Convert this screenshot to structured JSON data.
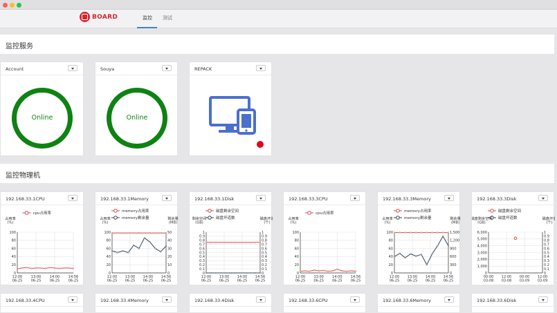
{
  "app": {
    "brand": "BOARD",
    "tabs": [
      {
        "label": "监控",
        "active": true
      },
      {
        "label": "测试",
        "active": false
      }
    ],
    "colors": {
      "brand": "#d7262d",
      "online": "#0e8212",
      "tab_underline": "#3a86c8",
      "status_dot": "#e8001c"
    }
  },
  "services": {
    "title": "监控服务",
    "cards": [
      {
        "name": "Account",
        "status": "Online",
        "icon": "ring"
      },
      {
        "name": "Souya",
        "status": "Online",
        "icon": "ring"
      },
      {
        "name": "REPACK",
        "status": "",
        "icon": "desktop-phone-icon",
        "status_dot": "red"
      }
    ]
  },
  "machines": {
    "title": "监控物理机",
    "row1": [
      {
        "name": "192.168.33.1CPU"
      },
      {
        "name": "192.168.33.1Memory"
      },
      {
        "name": "192.168.33.1Disk"
      },
      {
        "name": "192.168.33.3CPU"
      },
      {
        "name": "192.168.33.3Memory"
      },
      {
        "name": "192.168.33.3Disk"
      }
    ],
    "row2": [
      {
        "name": "192.168.33.4CPU"
      },
      {
        "name": "192.168.33.4Memory"
      },
      {
        "name": "192.168.33.4Disk"
      },
      {
        "name": "192.168.33.6CPU"
      },
      {
        "name": "192.168.33.6Memory"
      },
      {
        "name": "192.168.33.6Disk"
      }
    ]
  },
  "chart_data": [
    {
      "type": "line",
      "title": "192.168.33.1CPU",
      "legend": [
        "cpu占用率"
      ],
      "ylabel": "占用率\n(%)",
      "ylim": [
        0,
        100
      ],
      "yticks": [
        0,
        20,
        40,
        60,
        80,
        100
      ],
      "x": [
        "12:00\n06-25",
        "13:00\n06-25",
        "14:00\n06-25",
        "14:56\n06-25"
      ],
      "series": [
        {
          "name": "cpu占用率",
          "color": "#d94a4a",
          "values": [
            10,
            12,
            13,
            11,
            12,
            12,
            11,
            13,
            12,
            11,
            12,
            12,
            11
          ]
        }
      ]
    },
    {
      "type": "line",
      "title": "192.168.33.1Memory",
      "legend": [
        "memory占用率",
        "memory剩余量"
      ],
      "ylabel": "占用率\n(%)",
      "ylabel_right": "剩余量\n(MB)",
      "ylim": [
        0,
        100
      ],
      "yticks": [
        0,
        20,
        40,
        60,
        80,
        100
      ],
      "ylim_right": [
        0,
        50
      ],
      "yticks_right": [
        0,
        10,
        20,
        30,
        40,
        50
      ],
      "x": [
        "12:00\n06-25",
        "13:00\n06-25",
        "14:00\n06-25",
        "14:56\n06-25"
      ],
      "series": [
        {
          "name": "memory占用率",
          "color": "#d94a4a",
          "axis": "left",
          "values": [
            98,
            98,
            98,
            98,
            98,
            98,
            98,
            98,
            98,
            98,
            98
          ]
        },
        {
          "name": "memory剩余量",
          "color": "#2f4554",
          "axis": "right",
          "values": [
            27,
            25,
            27,
            25,
            34,
            30,
            43,
            38,
            30,
            26,
            33
          ]
        }
      ]
    },
    {
      "type": "line",
      "title": "192.168.33.1Disk",
      "legend": [
        "磁盘剩余空间",
        "磁盘坏道数"
      ],
      "ylabel": "剩余空间\n(GB)",
      "ylabel_right": "磁盘坏道\n(个)",
      "ylim": [
        0,
        1
      ],
      "yticks": [
        0,
        0.1,
        0.2,
        0.3,
        0.4,
        0.5,
        0.6,
        0.7,
        0.8,
        0.9,
        1.0
      ],
      "ylim_right": [
        0,
        1
      ],
      "yticks_right": [
        0,
        0.1,
        0.2,
        0.3,
        0.4,
        0.5,
        0.6,
        0.7,
        0.8,
        0.9,
        1.0
      ],
      "x": [
        "12:00\n06-25",
        "13:00\n06-25",
        "14:00\n06-25",
        "14:56\n06-25"
      ],
      "series": [
        {
          "name": "磁盘剩余空间",
          "color": "#d94a4a",
          "axis": "left",
          "values": [
            0.75,
            0.75,
            0.75,
            0.75,
            0.75,
            0.75,
            0.75,
            0.75,
            0.75,
            0.75,
            0.75,
            0.75
          ]
        },
        {
          "name": "磁盘坏道数",
          "color": "#2f4554",
          "axis": "right",
          "values": [
            0,
            0,
            0,
            0,
            0,
            0,
            0,
            0,
            0,
            0,
            0,
            0
          ]
        }
      ]
    },
    {
      "type": "line",
      "title": "192.168.33.3CPU",
      "legend": [
        "cpu占用率"
      ],
      "ylabel": "占用率\n(%)",
      "ylim": [
        0,
        100
      ],
      "yticks": [
        0,
        20,
        40,
        60,
        80,
        100
      ],
      "x": [
        "12:00\n06-25",
        "13:00\n06-25",
        "14:00\n06-25",
        "14:56\n06-25"
      ],
      "series": [
        {
          "name": "cpu占用率",
          "color": "#d94a4a",
          "values": [
            4,
            5,
            4,
            7,
            5,
            6,
            4,
            5,
            9,
            5,
            4,
            5,
            4
          ]
        }
      ]
    },
    {
      "type": "line",
      "title": "192.168.33.3Memory",
      "legend": [
        "memory占用率",
        "memory剩余量"
      ],
      "ylabel": "占用率\n(%)",
      "ylabel_right": "剩余量\n(MB)",
      "ylim": [
        0,
        100
      ],
      "yticks": [
        0,
        20,
        40,
        60,
        80,
        100
      ],
      "ylim_right": [
        0,
        1500
      ],
      "yticks_right": [
        0,
        300,
        600,
        900,
        1200,
        1500
      ],
      "x": [
        "12:00\n06-25",
        "13:00\n06-25",
        "14:00\n06-25",
        "14:56\n06-25"
      ],
      "series": [
        {
          "name": "memory占用率",
          "color": "#d94a4a",
          "axis": "left",
          "values": [
            99,
            99,
            99,
            99,
            99,
            99,
            99,
            99,
            99,
            99,
            99
          ]
        },
        {
          "name": "memory剩余量",
          "color": "#2f4554",
          "axis": "right",
          "values": [
            600,
            720,
            560,
            700,
            620,
            680,
            300,
            700,
            1000,
            1350,
            1000
          ]
        }
      ]
    },
    {
      "type": "scatter",
      "title": "192.168.33.3Disk",
      "legend": [
        "磁盘剩余空间",
        "磁盘坏道数"
      ],
      "ylabel": "磁盘剩余空间\n(GB)",
      "ylabel_right": "磁盘坏道\n(个)",
      "ylim": [
        0,
        6000
      ],
      "yticks": [
        0,
        1000,
        2000,
        3000,
        4000,
        5000,
        6000
      ],
      "ylim_right": [
        0,
        1
      ],
      "yticks_right": [
        0,
        0.1,
        0.2,
        0.3,
        0.4,
        0.5,
        0.6,
        0.7,
        0.8,
        0.9,
        1.0
      ],
      "x": [
        "00:00\n03-08",
        "12:00\n03-08",
        "00:00\n03-09",
        "12:00\n03-09"
      ],
      "series": [
        {
          "name": "磁盘剩余空间",
          "color": "#d94a4a",
          "axis": "left",
          "points": [
            {
              "x": 1.5,
              "y": 5100
            }
          ]
        }
      ]
    }
  ]
}
